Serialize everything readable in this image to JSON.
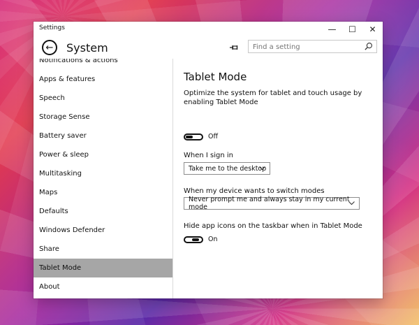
{
  "window": {
    "title": "Settings",
    "minimize_glyph": "—",
    "maximize_glyph": "☐",
    "close_glyph": "✕"
  },
  "header": {
    "title": "System",
    "back_icon": "back-arrow-icon",
    "pin_icon": "pin-icon",
    "search_placeholder": "Find a setting",
    "search_value": ""
  },
  "sidebar": {
    "items": [
      {
        "label": "Notifications & actions"
      },
      {
        "label": "Apps & features"
      },
      {
        "label": "Speech"
      },
      {
        "label": "Storage Sense"
      },
      {
        "label": "Battery saver"
      },
      {
        "label": "Power & sleep"
      },
      {
        "label": "Multitasking"
      },
      {
        "label": "Maps"
      },
      {
        "label": "Defaults"
      },
      {
        "label": "Windows Defender"
      },
      {
        "label": "Share"
      },
      {
        "label": "Tablet Mode",
        "selected": true
      },
      {
        "label": "About"
      }
    ]
  },
  "content": {
    "title": "Tablet Mode",
    "optimize_description": "Optimize the system for tablet and touch usage by enabling Tablet Mode",
    "tablet_mode_toggle": {
      "state": "Off",
      "is_on": false
    },
    "sign_in_label": "When I sign in",
    "sign_in_value": "Take me to the desktop",
    "switch_modes_label": "When my device wants to switch modes",
    "switch_modes_value": "Never prompt me and always stay in my current mode",
    "hide_icons_label": "Hide app icons on the taskbar when in Tablet Mode",
    "hide_icons_toggle": {
      "state": "On",
      "is_on": true
    }
  },
  "colors": {
    "sidebar_selected": "#a6a6a6",
    "window_bg": "#ffffff",
    "text": "#111111"
  }
}
